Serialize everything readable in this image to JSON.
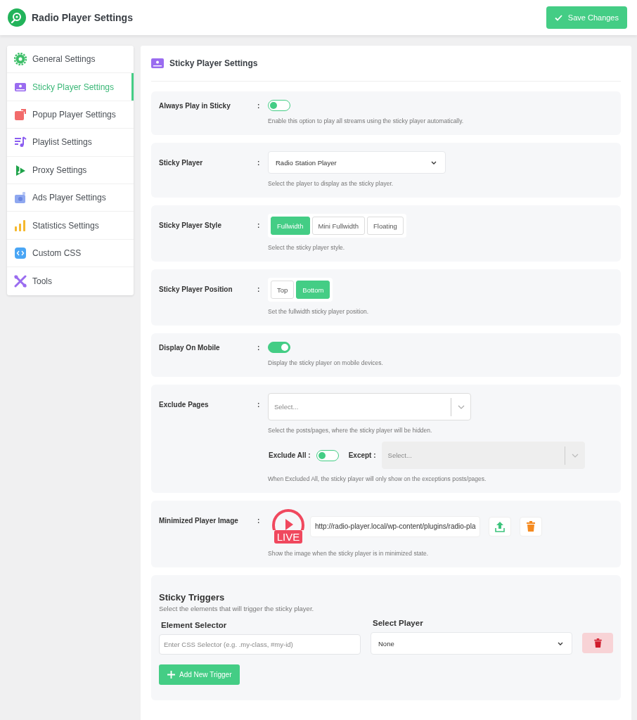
{
  "header": {
    "title": "Radio Player Settings",
    "save_button": "Save Changes"
  },
  "sidebar": {
    "items": [
      {
        "label": "General Settings",
        "selected": false
      },
      {
        "label": "Sticky Player Settings",
        "selected": true
      },
      {
        "label": "Popup Player Settings",
        "selected": false
      },
      {
        "label": "Playlist Settings",
        "selected": false
      },
      {
        "label": "Proxy Settings",
        "selected": false
      },
      {
        "label": "Ads Player Settings",
        "selected": false
      },
      {
        "label": "Statistics Settings",
        "selected": false
      },
      {
        "label": "Custom CSS",
        "selected": false
      },
      {
        "label": "Tools",
        "selected": false
      }
    ]
  },
  "panel": {
    "title": "Sticky Player Settings",
    "settings": [
      {
        "kind": "toggle",
        "label": "Always Play in Sticky",
        "separator": ":",
        "on": false,
        "help": "Enable this option to play all streams using the sticky player automatically."
      },
      {
        "kind": "select",
        "label": "Sticky Player",
        "separator": ":",
        "value": "Radio Station Player",
        "help": "Select the player to display as the sticky player."
      },
      {
        "kind": "choice",
        "label": "Sticky Player Style",
        "separator": ":",
        "options": [
          {
            "label": "Fullwidth",
            "selected": true
          },
          {
            "label": "Mini Fullwidth",
            "selected": false
          },
          {
            "label": "Floating",
            "selected": false
          }
        ],
        "help": "Select the sticky player style."
      },
      {
        "kind": "choice",
        "label": "Sticky Player Position",
        "separator": ":",
        "options": [
          {
            "label": "Top",
            "selected": false
          },
          {
            "label": "Bottom",
            "selected": true
          }
        ],
        "help": "Set the fullwidth sticky player position."
      },
      {
        "kind": "toggle",
        "label": "Display On Mobile",
        "separator": ":",
        "on": true,
        "help": "Display the sticky player on mobile devices."
      },
      {
        "kind": "exclude",
        "label": "Exclude Pages",
        "separator": ":",
        "placeholder": "Select...",
        "help": "Select the posts/pages, where the sticky player will be hidden.",
        "exclude_all_label": "Exclude All :",
        "exclude_all_on": false,
        "except_label": "Except :",
        "except_placeholder": "Select...",
        "except_disabled": true,
        "note": "When Excluded All, the sticky player will only show on the exceptions posts/pages."
      },
      {
        "kind": "image",
        "label": "Minimized Player Image",
        "separator": ":",
        "live_badge": "LIVE",
        "url": "http://radio-player.local/wp-content/plugins/radio-pla",
        "help": "Show the image when the sticky player is in minimized state."
      }
    ]
  },
  "triggers": {
    "title": "Sticky Triggers",
    "subtitle": "Select the elements that will trigger the sticky player.",
    "selector_label": "Element Selector",
    "selector_placeholder": "Enter CSS Selector (e.g. .my-class, #my-id)",
    "player_label": "Select Player",
    "player_value": "None",
    "add_button": "Add New Trigger"
  }
}
